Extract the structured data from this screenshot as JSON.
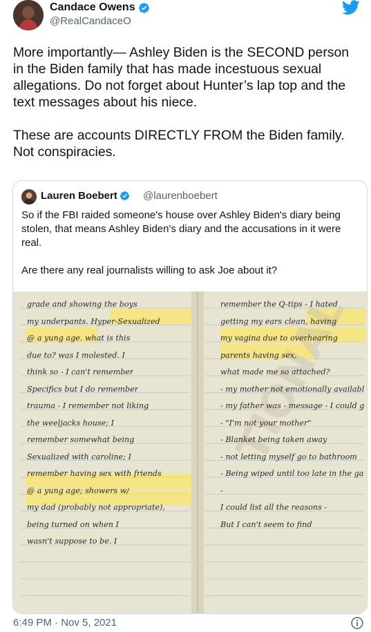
{
  "author": {
    "display_name": "Candace Owens",
    "handle": "@RealCandaceO"
  },
  "tweet": {
    "paragraphs": [
      "More importantly— Ashley Biden is the SECOND person in the Biden family that has made incestuous sexual allegations. Do not forget about Hunter’s lap top and the text messages about his niece.",
      "These are accounts DIRECTLY FROM the Biden family. Not conspiracies."
    ],
    "timestamp": "6:49 PM · Nov 5, 2021"
  },
  "quoted": {
    "display_name": "Lauren Boebert",
    "handle": "@laurenboebert",
    "paragraphs": [
      "So if the FBI raided someone's house over Ashley Biden's diary being stolen, that means Ashley Biden's diary and the accusations in it were real.",
      "Are there any real journalists willing to ask Joe about it?"
    ],
    "image": {
      "left_page": [
        "grade and showing the boys",
        "my underpants. Hyper-Sexualized",
        "@ a yung age. what is this",
        "due to? was I molested. I",
        "think so - I can't remember",
        "Specifics but I do remember",
        "trauma - I remember not liking",
        "the weeljacks house; I",
        "remember somewhat being",
        "Sexualized with caroline; I",
        "remember having sex with friends",
        "@ a yung age; showers w/",
        "my dad (probably not appropriate),",
        "being turned on when I",
        "wasn't suppose to be. I"
      ],
      "right_page": [
        "remember the Q-tips - I hated",
        "getting my ears clean, having",
        "my vagina due to overhearing",
        "parents having sex,",
        "what made me so attached?",
        "- my mother not emotionally available -",
        "- my father was - message - I could get love from men",
        "- \"I'm not your mother\"",
        "- Blanket being taken away",
        "- not letting myself go to bathroom",
        "- Being wiped until too late in the game -",
        "-",
        "I could list all the reasons -",
        "But I can't seem to find"
      ]
    }
  },
  "colors": {
    "verified_blue": "#1d9bf0",
    "twitter_blue": "#1d9bf0",
    "secondary_text": "#536471",
    "highlight": "#ffe646"
  },
  "icons": [
    "verified-badge-icon",
    "twitter-bird-icon",
    "info-icon"
  ]
}
